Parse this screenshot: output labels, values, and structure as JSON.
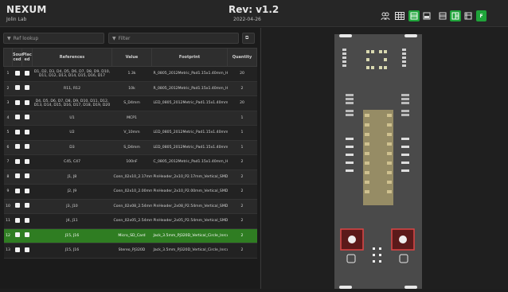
{
  "header": {
    "title": "NEXUM",
    "subtitle": "Jolin Lab",
    "revision": "Rev: v1.2",
    "date": "2022-04-26"
  },
  "toolbar": {
    "layer_front": "F",
    "layer_fb": "FB",
    "layer_back": "B"
  },
  "filters": {
    "ref_placeholder": "Ref lookup",
    "filter_placeholder": "Filter"
  },
  "table": {
    "headers": [
      "",
      "Sour ced",
      "Plac ed",
      "References",
      "Value",
      "Footprint",
      "Quantity"
    ],
    "rows": [
      {
        "n": "1",
        "refs": "D1, D2, D3, D4, D5, D6, D7, D8, D9, D10, D11, D12, D13, D14, D15, D16, D17",
        "value": "1.3k",
        "fp": "R_0805_2012Metric_Pad1.15x1.40mm_HandSolder",
        "qty": "20"
      },
      {
        "n": "2",
        "refs": "R11, R12",
        "value": "10k",
        "fp": "R_0805_2012Metric_Pad1.15x1.40mm_HandSolder",
        "qty": "2"
      },
      {
        "n": "3",
        "refs": "D4, D5, D6, D7, D8, D9, D10, D11, D12, D13, D14, D15, D16, D17, D18, D19, D20",
        "value": "S_D4mm",
        "fp": "LED_0805_2012Metric_Pad1.15x1.40mm_HandSolder",
        "qty": "20"
      },
      {
        "n": "4",
        "refs": "U1",
        "value": "MCP1",
        "fp": "",
        "qty": "1"
      },
      {
        "n": "5",
        "refs": "U2",
        "value": "V_10mm",
        "fp": "LED_0805_2012Metric_Pad1.15x1.40mm_HandSolder",
        "qty": "1"
      },
      {
        "n": "6",
        "refs": "D3",
        "value": "S_D4mm",
        "fp": "LED_0805_2012Metric_Pad1.15x1.40mm_HandSolder",
        "qty": "1"
      },
      {
        "n": "7",
        "refs": "C45, C47",
        "value": "100nF",
        "fp": "C_0805_2012Metric_Pad1.15x1.40mm_HandSolder",
        "qty": "2"
      },
      {
        "n": "8",
        "refs": "J1, J8",
        "value": "Conn_02x10_2.17mm",
        "fp": "PinHeader_2x10_P2.17mm_Vertical_SMD",
        "qty": "2"
      },
      {
        "n": "9",
        "refs": "J2, J9",
        "value": "Conn_02x10_2.00mm",
        "fp": "PinHeader_2x10_P2.00mm_Vertical_SMD",
        "qty": "2"
      },
      {
        "n": "10",
        "refs": "J3, J10",
        "value": "Conn_02x08_2.54mm",
        "fp": "PinHeader_2x08_P2.54mm_Vertical_SMD",
        "qty": "2"
      },
      {
        "n": "11",
        "refs": "J4, J11",
        "value": "Conn_02x05_2.54mm",
        "fp": "PinHeader_2x05_P2.54mm_Vertical_SMD",
        "qty": "2"
      },
      {
        "n": "12",
        "refs": "J15, J16",
        "value": "Micro_SD_Card",
        "fp": "Jack_3.5mm_PJ320D_Vertical_Circle_Inrcular_no_hole",
        "qty": "2"
      },
      {
        "n": "13",
        "refs": "J15, J16",
        "value": "Stereo_PJ320D",
        "fp": "Jack_3.5mm_PJ320D_Vertical_Circle_Inrcular_no_hole",
        "qty": "2"
      }
    ]
  },
  "colors": {
    "accent_green": "#1fa43a",
    "selected_row": "#2f7d22"
  },
  "icons": [
    "people-icon",
    "table-icon",
    "bom-left-icon",
    "split-icon",
    "bom-top-icon",
    "bom-right-icon",
    "pcb-icon",
    "settings-icon",
    "copy-icon",
    "filter-icon"
  ]
}
